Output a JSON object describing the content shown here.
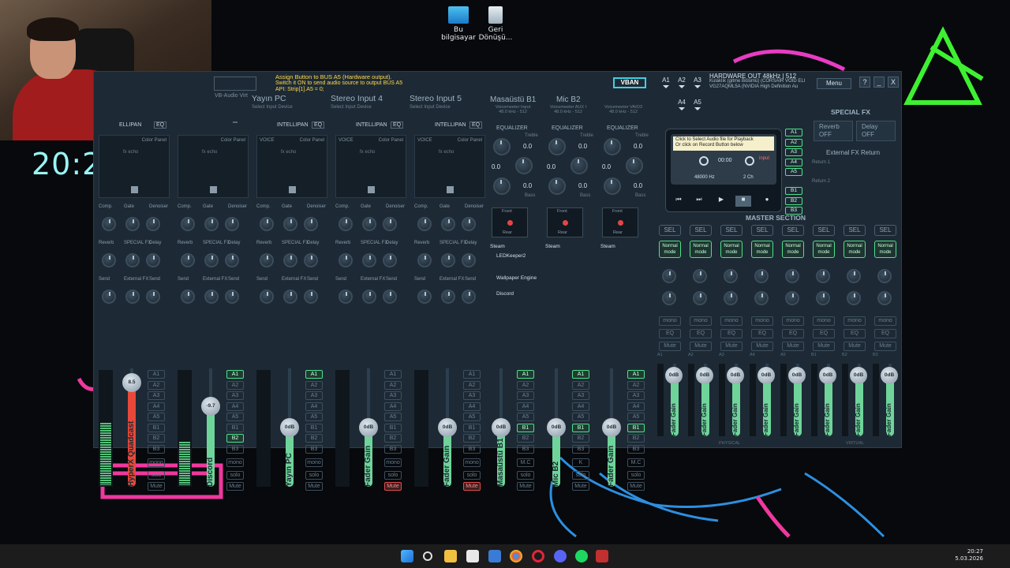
{
  "desktop": {
    "icons": [
      {
        "label": "Bu bilgisayar"
      },
      {
        "label": "Geri Dönüşü..."
      }
    ],
    "clock_overlay": "20:2"
  },
  "voicemeeter": {
    "assign_title": "Assign Button to BUS A5 (Hardware output).",
    "assign_line2": "Switch it ON to send audio source to output BUS A5",
    "assign_line3": "API: Strip[1].A5 = 0;",
    "logo_sub": "VB-Audio Virt",
    "vban": "VBAN",
    "a_buttons": [
      "A1",
      "A2",
      "A3",
      "A4",
      "A5"
    ],
    "hw_out_title": "HARDWARE OUT 48kHz | 512",
    "hw_out_line1": "Kulaklık (gitme Bölümü) (CORSAIR VOID ELI",
    "hw_out_line2": "VG27AQML5A (NVIDIA High Definition Au",
    "menu": "Menu",
    "help": "?",
    "minimize": "_",
    "close": "X",
    "strips": [
      {
        "title": "",
        "sub": "",
        "intelli": "ELLIPAN",
        "eq": "EQ",
        "pan_a": "",
        "pan_b": "Color Panel",
        "pan_c": "fx echo",
        "fader_label": "HyperX Quadcast",
        "fader_value": "8.5",
        "muted": false
      },
      {
        "title": "",
        "sub": "",
        "intelli": "",
        "eq": "",
        "pan_a": "",
        "pan_b": "Color Panel",
        "pan_c": "fx echo",
        "fader_label": "Discord",
        "fader_value": "-9.7",
        "muted": false
      },
      {
        "title": "Yayın PC",
        "sub": "Select Input Device",
        "intelli": "INTELLIPAN",
        "eq": "EQ",
        "pan_a": "VOICE",
        "pan_b": "Color Panel",
        "pan_c": "fx echo",
        "fader_label": "Yayın PC",
        "fader_value": "0dB",
        "muted": false
      },
      {
        "title": "Stereo Input 4",
        "sub": "Select Input Device",
        "intelli": "INTELLIPAN",
        "eq": "EQ",
        "pan_a": "VOICE",
        "pan_b": "Color Panel",
        "pan_c": "fx echo",
        "fader_label": "Fader Gain",
        "fader_value": "0dB",
        "muted": true
      },
      {
        "title": "Stereo Input 5",
        "sub": "Select Input Device",
        "intelli": "INTELLIPAN",
        "eq": "EQ",
        "pan_a": "VOICE",
        "pan_b": "Color Panel",
        "pan_c": "fx echo",
        "fader_label": "Fader Gain",
        "fader_value": "0dB",
        "muted": true
      }
    ],
    "knob_labels": {
      "comp": "Comp.",
      "gate": "Gate",
      "denoiser": "Denoiser",
      "reverb": "Reverb",
      "special_fx": "SPECIAL FX",
      "delay": "Delay",
      "send": "Send",
      "external_fx": "External FX"
    },
    "bus_buttons": [
      "A1",
      "A2",
      "A3",
      "A4",
      "A5",
      "B1",
      "B2",
      "B3"
    ],
    "strip_buttons": {
      "mono": "mono",
      "solo": "solo",
      "mute": "Mute"
    },
    "virtual": [
      {
        "title": "Masaüstü B1",
        "sub1": "Voicemeeter Input",
        "sub2": "48.0 kHz - 512",
        "fader_label": "Masaüstü B1",
        "fader_value": "0dB",
        "app1": "Steam",
        "app2": "LEDKeeper2",
        "app3": "Wallpaper Engine",
        "app4": "Discord",
        "mc": "M.C"
      },
      {
        "title": "Mic B2",
        "sub1": "Voicemeeter AUX I",
        "sub2": "48.0 kHz - 512",
        "fader_label": "Mic B2",
        "fader_value": "0dB",
        "app1": "Steam",
        "mc": "K"
      },
      {
        "title": "",
        "sub1": "Voicemeeter VAIO3",
        "sub2": "48.0 kHz - 512",
        "fader_label": "Fader Gain",
        "fader_value": "0dB",
        "app1": "Steam",
        "mc": "M.C"
      }
    ],
    "equalizer": {
      "title": "EQUALIZER",
      "treble": "Treble",
      "bass": "Bass",
      "value": "0.0"
    },
    "surround": {
      "front": "Front",
      "rear": "Rear"
    },
    "recorder": {
      "tip1": "Click to Select Audio file for Playback",
      "tip2": "Or click on Record Button below",
      "time": "00:00",
      "input": "input",
      "freq": "48000 Hz",
      "ch": "2 Ch"
    },
    "rec_routes": [
      "A1",
      "A2",
      "A3",
      "A4",
      "A5",
      "B1",
      "B2",
      "B3"
    ],
    "special_fx": {
      "title": "SPECIAL FX",
      "reverb": "Reverb",
      "reverb_state": "OFF",
      "delay": "Delay",
      "delay_state": "OFF",
      "ext_return": "External FX Return",
      "return1": "Return 1",
      "return2": "Return 2"
    },
    "master": {
      "title": "MASTER SECTION",
      "sel": "SEL",
      "normal_mode": "Normal mode",
      "mono": "mono",
      "eq": "EQ",
      "mute": "Mute",
      "fader_label": "Fader Gain",
      "fader_value": "0dB",
      "physical": "PHYSICAL",
      "virtual": "VIRTUAL"
    },
    "master_buses": [
      "A1",
      "A2",
      "A3",
      "A4",
      "A5",
      "B1",
      "B2",
      "B3"
    ]
  },
  "taskbar": {
    "time": "20:27",
    "date": "5.03.2026"
  },
  "colors": {
    "accent_green": "#4fe08a",
    "mute_red": "#e24b4b",
    "hyperx_fader": "#e8483a",
    "fader_green": "#6fd49a",
    "vban": "#40d0e0"
  }
}
